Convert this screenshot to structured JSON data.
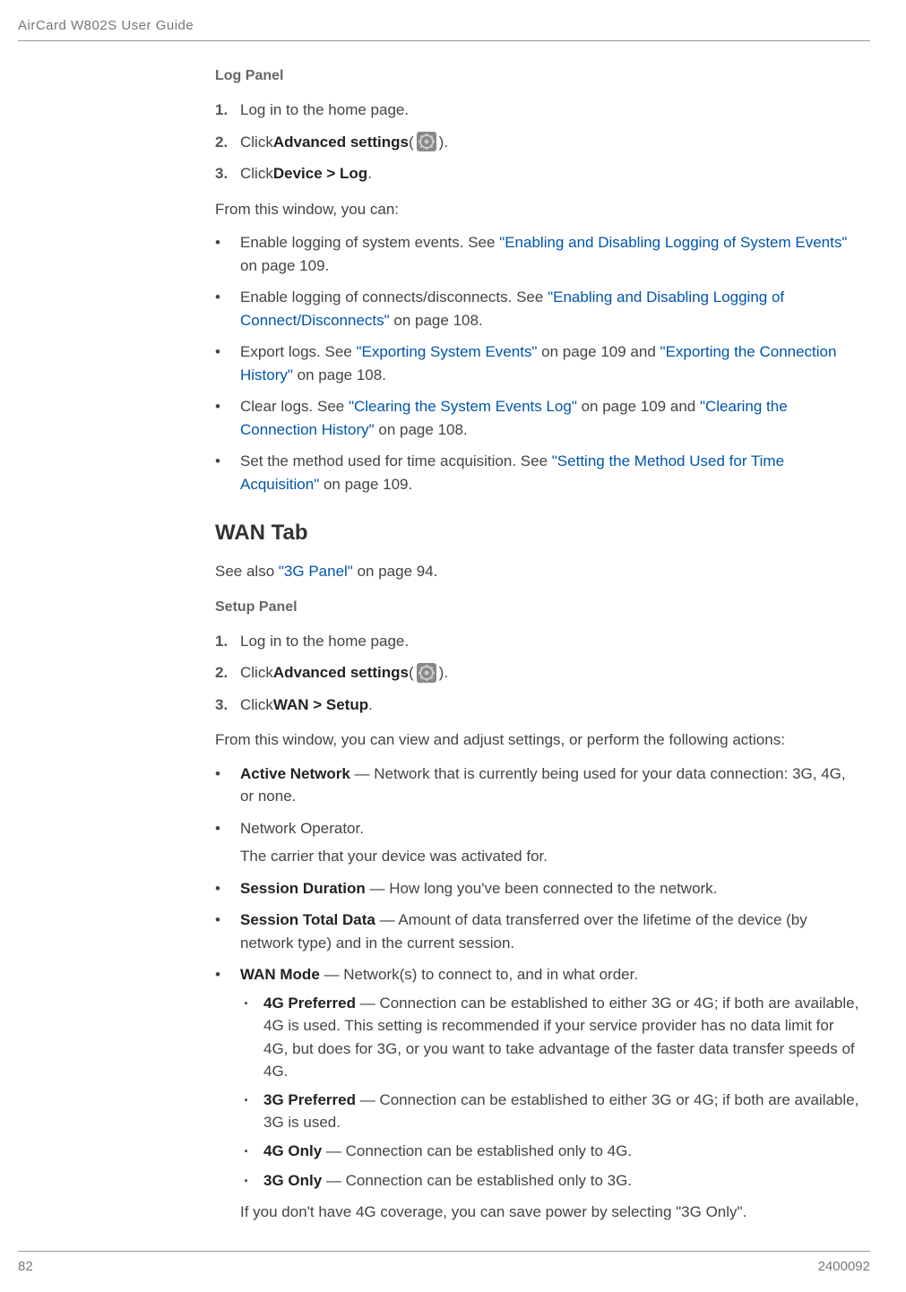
{
  "header": {
    "title": "AirCard W802S User Guide"
  },
  "sections": {
    "logPanel": {
      "title": "Log Panel",
      "steps": [
        {
          "num": "1.",
          "text": "Log in to the home page."
        },
        {
          "num": "2.",
          "prefix": "Click ",
          "bold": "Advanced settings",
          "suffix1": " (",
          "suffix2": ")."
        },
        {
          "num": "3.",
          "prefix": "Click ",
          "bold": "Device > Log",
          "suffix": "."
        }
      ],
      "intro": "From this window, you can:",
      "bullets": [
        {
          "pre": "Enable logging of system events. See ",
          "link1": "\"Enabling and Disabling Logging of System Events\"",
          "post1": " on page 109."
        },
        {
          "pre": "Enable logging of connects/disconnects. See ",
          "link1": "\"Enabling and Disabling Logging of Connect/Disconnects\"",
          "post1": " on page 108."
        },
        {
          "pre": "Export logs. See ",
          "link1": "\"Exporting System Events\"",
          "mid1": " on page 109 and ",
          "link2": "\"Exporting the Connection History\"",
          "post1": " on page 108."
        },
        {
          "pre": "Clear logs. See ",
          "link1": "\"Clearing the System Events Log\"",
          "mid1": " on page 109 and ",
          "link2": "\"Clearing the Connection History\"",
          "post1": " on page 108."
        },
        {
          "pre": "Set the method used for time acquisition. See ",
          "link1": "\"Setting the Method Used for Time Acquisition\"",
          "post1": " on page 109."
        }
      ]
    },
    "wanTab": {
      "title": "WAN Tab",
      "seeAlso": {
        "pre": "See also ",
        "link": "\"3G Panel\"",
        "post": " on page 94."
      }
    },
    "setupPanel": {
      "title": "Setup Panel",
      "steps": [
        {
          "num": "1.",
          "text": "Log in to the home page."
        },
        {
          "num": "2.",
          "prefix": "Click ",
          "bold": "Advanced settings",
          "suffix1": " (",
          "suffix2": ")."
        },
        {
          "num": "3.",
          "prefix": "Click ",
          "bold": "WAN > Setup",
          "suffix": "."
        }
      ],
      "intro": "From this window, you can view and adjust settings, or perform the following actions:",
      "bullets": [
        {
          "bold": "Active Network",
          "text": " — Network that is currently being used for your data connection: 3G, 4G, or none."
        },
        {
          "text": "Network Operator.",
          "note": "The carrier that your device was activated for."
        },
        {
          "bold": "Session Duration",
          "text": " — How long you've been connected to the network."
        },
        {
          "bold": "Session Total Data",
          "text": " — Amount of data transferred over the lifetime of the device (by network type) and in the current session."
        },
        {
          "bold": "WAN Mode",
          "text": " — Network(s) to connect to, and in what order.",
          "sub": [
            {
              "bold": "4G Preferred",
              "text": " — Connection can be established to either 3G or 4G; if both are available, 4G is used. This setting is recommended if your service provider has no data limit for 4G, but does for 3G, or you want to take advantage of the faster data transfer speeds of 4G."
            },
            {
              "bold": "3G Preferred",
              "text": " — Connection can be established to either 3G or 4G; if both are available, 3G is used."
            },
            {
              "bold": "4G Only",
              "text": " — Connection can be established only to 4G."
            },
            {
              "bold": "3G Only",
              "text": " — Connection can be established only to 3G."
            }
          ],
          "subNote": "If you don't have 4G coverage, you can save power by selecting \"3G Only\"."
        }
      ]
    }
  },
  "footer": {
    "page": "82",
    "doc": "2400092"
  }
}
